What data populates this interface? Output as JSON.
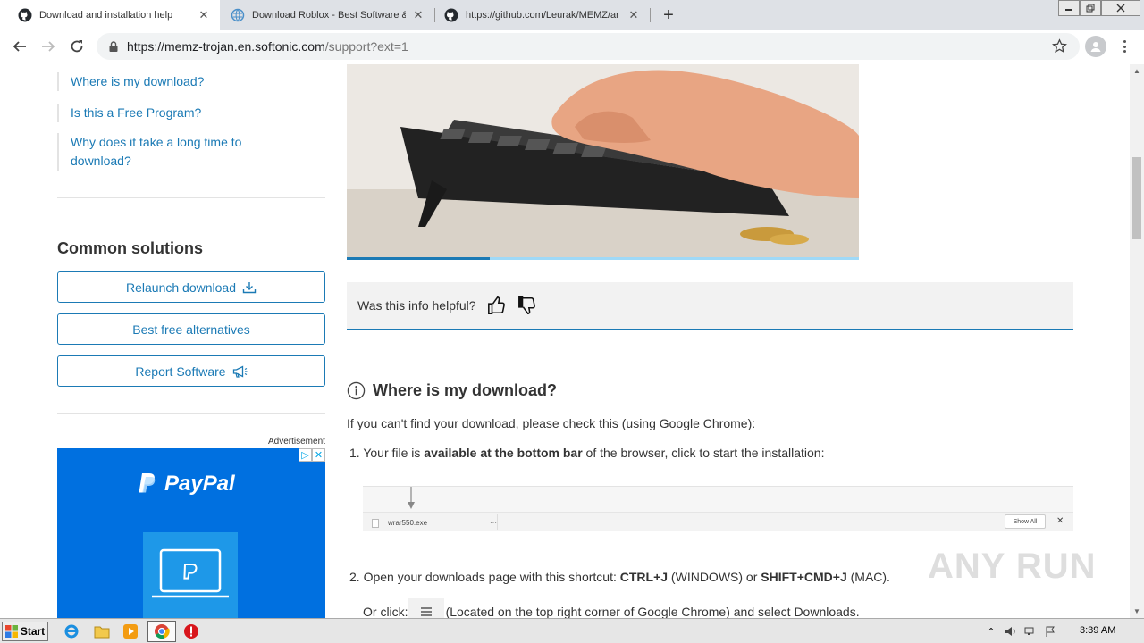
{
  "browser": {
    "tabs": [
      {
        "title": "Download and installation help",
        "active": true,
        "favicon": "github-icon"
      },
      {
        "title": "Download Roblox - Best Software &",
        "active": false,
        "favicon": "globe-icon"
      },
      {
        "title": "https://github.com/Leurak/MEMZ/ar",
        "active": false,
        "favicon": "github-icon"
      }
    ],
    "url_host": "https://memz-trojan.en.softonic.com",
    "url_path": "/support?ext=1"
  },
  "sidebar": {
    "links": [
      {
        "label": "Where is my download?"
      },
      {
        "label": "Is this a Free Program?"
      },
      {
        "label": "Why does it take a long time to download?"
      }
    ],
    "common_title": "Common solutions",
    "buttons": [
      {
        "label": "Relaunch download",
        "icon": "download-icon"
      },
      {
        "label": "Best free alternatives",
        "icon": ""
      },
      {
        "label": "Report Software",
        "icon": "megaphone-icon"
      }
    ],
    "ad_label": "Advertisement",
    "ad_brand": "PayPal",
    "ad_badge_info": "▷",
    "ad_badge_close": "✕"
  },
  "main": {
    "video_progress": 0.28,
    "feedback_question": "Was this info helpful?",
    "section_title": "Where is my download?",
    "intro": "If you can't find your download, please check this (using Google Chrome):",
    "step1_number": "1.",
    "step1_pre": "Your file is ",
    "step1_bold": "available at the bottom bar",
    "step1_post": " of the browser, click to start the installation:",
    "download_bar": {
      "file_name": "wrar550.exe",
      "more": "···",
      "show_all": "Show All",
      "close": "✕"
    },
    "step2_number": "2.",
    "step2_pre": "Open your downloads page with this shortcut: ",
    "step2_bold1": "CTRL+J",
    "step2_mid1": " (WINDOWS) or ",
    "step2_bold2": "SHIFT+CMD+J",
    "step2_post": " (MAC).",
    "orclick_pre": "Or click:",
    "orclick_post": "(Located on the top right corner of Google Chrome) and select Downloads."
  },
  "watermark": "ANY RUN",
  "taskbar": {
    "start_label": "Start",
    "clock": "3:39 AM"
  },
  "colors": {
    "link": "#1b7ab5",
    "ad_bg": "#0070e0"
  }
}
